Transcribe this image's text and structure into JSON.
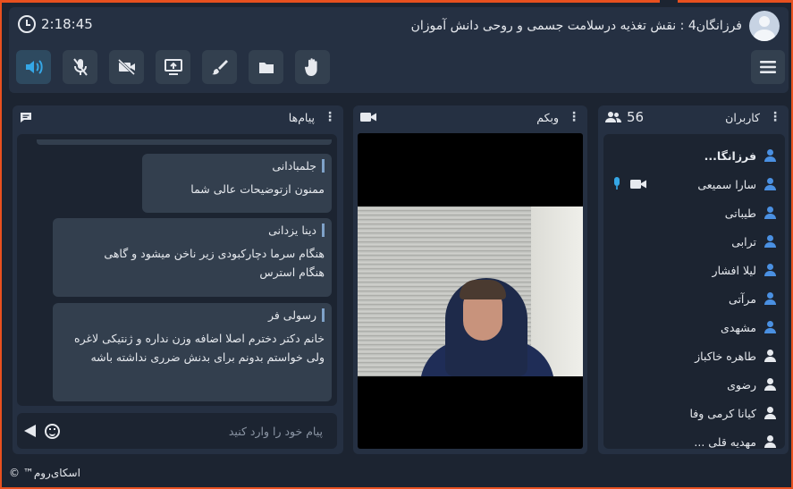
{
  "header": {
    "time": "2:18:45",
    "title": "فرزانگان4 : نقش تغذیه درسلامت جسمی و روحی دانش آموزان"
  },
  "toolbar": {
    "buttons": [
      "speaker-icon",
      "mic-off-icon",
      "camera-off-icon",
      "screen-share-icon",
      "brush-icon",
      "folder-icon",
      "hand-raise-icon"
    ],
    "menu": "hamburger-menu-icon"
  },
  "users_panel": {
    "title": "کاربران",
    "count": "56",
    "users": [
      {
        "name": "فرزانگا...",
        "bold": true,
        "color": "#4a90e2"
      },
      {
        "name": "سارا سمیعی",
        "bold": false,
        "color": "#4a90e2",
        "has_media": true
      },
      {
        "name": "طیباتی",
        "bold": false,
        "color": "#4a90e2"
      },
      {
        "name": "ترابی",
        "bold": false,
        "color": "#4a90e2"
      },
      {
        "name": "لیلا افشار",
        "bold": false,
        "color": "#4a90e2"
      },
      {
        "name": "مرآتی",
        "bold": false,
        "color": "#4a90e2"
      },
      {
        "name": "مشهدی",
        "bold": false,
        "color": "#4a90e2"
      },
      {
        "name": "طاهره خاکباز",
        "bold": false,
        "color": "#e6e9ee"
      },
      {
        "name": "رضوی",
        "bold": false,
        "color": "#e6e9ee"
      },
      {
        "name": "کیانا کرمی وفا",
        "bold": false,
        "color": "#e6e9ee"
      },
      {
        "name": "مهدیه قلی ...",
        "bold": false,
        "color": "#e6e9ee"
      }
    ]
  },
  "webcam_panel": {
    "title": "وبکم"
  },
  "messages_panel": {
    "title": "پیام‌ها",
    "messages": [
      {
        "sender": "جلمبادانی",
        "text": "ممنون ازتوضیحات عالی شما"
      },
      {
        "sender": "دینا یزدانی",
        "text": "هنگام سرما دچارکبودی زیر ناخن میشود و گاهی هنگام استرس"
      },
      {
        "sender": "رسولی فر",
        "text": "خانم دکتر دخترم اصلا اضافه وزن نداره و ژنتیکی لاغره ولی خواستم بدونم برای بدنش ضرری نداشته باشه"
      }
    ],
    "input_placeholder": "پیام خود را وارد کنید"
  },
  "footer": {
    "brand": "اسکای‌روم™ ©"
  },
  "colors": {
    "accent": "#4a90e2",
    "frame": "#e8501f",
    "background": "#1c2431",
    "panel": "#253042"
  }
}
